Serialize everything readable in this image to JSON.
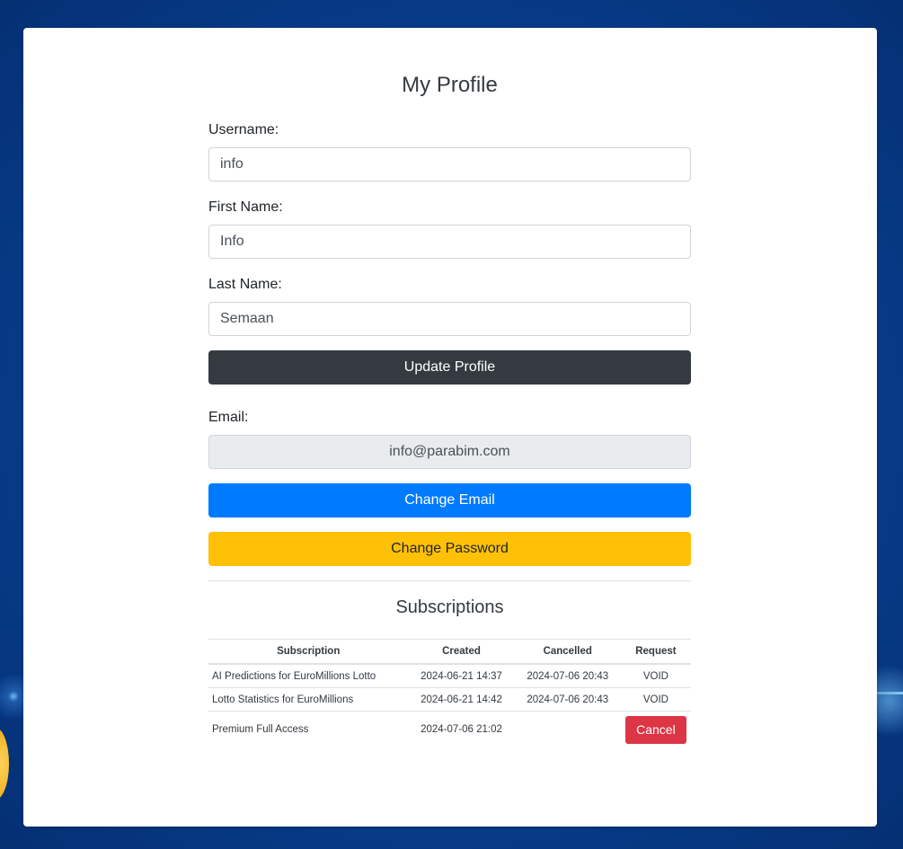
{
  "profile": {
    "title": "My Profile",
    "username_label": "Username:",
    "username_value": "info",
    "first_name_label": "First Name:",
    "first_name_value": "Info",
    "last_name_label": "Last Name:",
    "last_name_value": "Semaan",
    "update_button": "Update Profile",
    "email_label": "Email:",
    "email_value": "info@parabim.com",
    "change_email_button": "Change Email",
    "change_password_button": "Change Password"
  },
  "subscriptions": {
    "title": "Subscriptions",
    "headers": {
      "subscription": "Subscription",
      "created": "Created",
      "cancelled": "Cancelled",
      "request": "Request"
    },
    "rows": [
      {
        "subscription": "AI Predictions for EuroMillions Lotto",
        "created": "2024-06-21 14:37",
        "cancelled": "2024-07-06 20:43",
        "request": "VOID"
      },
      {
        "subscription": "Lotto Statistics for EuroMillions",
        "created": "2024-06-21 14:42",
        "cancelled": "2024-07-06 20:43",
        "request": "VOID"
      },
      {
        "subscription": "Premium Full Access",
        "created": "2024-07-06 21:02",
        "cancelled": "",
        "request_button": "Cancel"
      }
    ]
  },
  "colors": {
    "primary": "#007bff",
    "warning": "#ffc107",
    "dark": "#343a40",
    "danger": "#dc3545",
    "background": "#063f8f"
  }
}
